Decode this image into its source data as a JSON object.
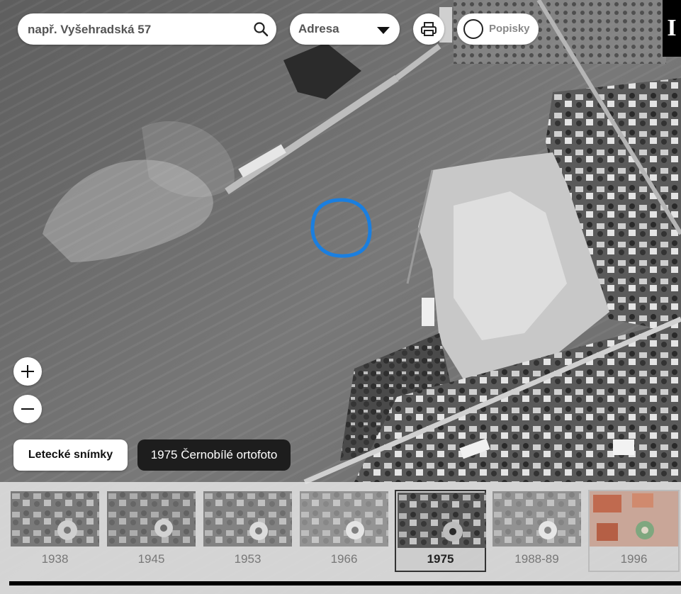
{
  "search": {
    "placeholder": "např. Vyšehradská 57"
  },
  "search_type": {
    "selected": "Adresa"
  },
  "labels_toggle": {
    "label": "Popisky"
  },
  "info": {
    "label": "I"
  },
  "layer": {
    "button_label": "Letecké snímky",
    "current_name": "1975 Černobílé ortofoto"
  },
  "timeline": {
    "years": [
      {
        "label": "1938"
      },
      {
        "label": "1945"
      },
      {
        "label": "1953"
      },
      {
        "label": "1966"
      },
      {
        "label": "1975",
        "active": true
      },
      {
        "label": "1988-89"
      },
      {
        "label": "1996"
      }
    ]
  },
  "colors": {
    "highlight_circle": "#1a7fe0",
    "dark": "#1d1d1d"
  },
  "icons": [
    "search-icon",
    "dropdown-arrow-icon",
    "print-icon",
    "circle-toggle-icon",
    "zoom-in-icon",
    "zoom-out-icon"
  ]
}
